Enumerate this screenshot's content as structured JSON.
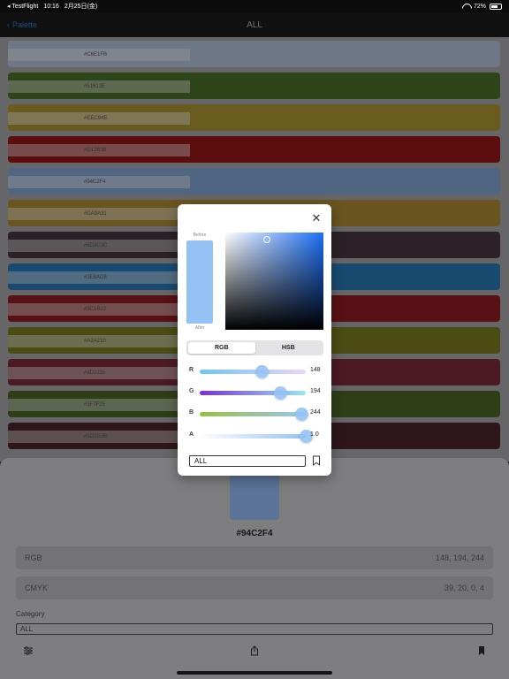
{
  "status_bar": {
    "app": "◂ TestFlight",
    "time": "10:16",
    "date": "2月25日(金)",
    "battery": "72%"
  },
  "nav": {
    "back_label": "Palette",
    "title": "ALL"
  },
  "palette_rows": [
    {
      "color": "#6e7786",
      "hex": "#C6E1FB"
    },
    {
      "color": "#2e4519",
      "hex": "#51613E"
    },
    {
      "color": "#6a5b1f",
      "hex": "#EEC94E"
    },
    {
      "color": "#5c0d0d",
      "hex": "#D12B3B"
    },
    {
      "color": "#4f6582",
      "hex": "#94C2F4"
    },
    {
      "color": "#6a5520",
      "hex": "#DA9A31"
    },
    {
      "color": "#2b2126",
      "hex": "#6D3C3C"
    },
    {
      "color": "#184a70",
      "hex": "#3E8AD8"
    },
    {
      "color": "#581114",
      "hex": "#9C1B22"
    },
    {
      "color": "#4b4c14",
      "hex": "#A2A210"
    },
    {
      "color": "#4c1a25",
      "hex": "#8D2235"
    },
    {
      "color": "#2e3e17",
      "hex": "#5F7F25"
    },
    {
      "color": "#2f161b",
      "hex": "#5D2D3B"
    }
  ],
  "sheet": {
    "hex": "#94C2F4",
    "rgb_label": "RGB",
    "rgb_value": "148, 194, 244",
    "cmyk_label": "CMYK",
    "cmyk_value": "39, 20, 0, 4",
    "category_label": "Category",
    "category_value": "ALL"
  },
  "picker": {
    "before_label": "Before",
    "after_label": "After",
    "current_color": "#94C2F4",
    "tabs": [
      "RGB",
      "HSB"
    ],
    "active_tab": "RGB",
    "channels": [
      {
        "label": "R",
        "value": "148",
        "fraction": 0.58
      },
      {
        "label": "G",
        "value": "194",
        "fraction": 0.76
      },
      {
        "label": "B",
        "value": "244",
        "fraction": 0.96
      },
      {
        "label": "A",
        "value": "1.0",
        "fraction": 1.0
      }
    ],
    "category_value": "ALL"
  }
}
